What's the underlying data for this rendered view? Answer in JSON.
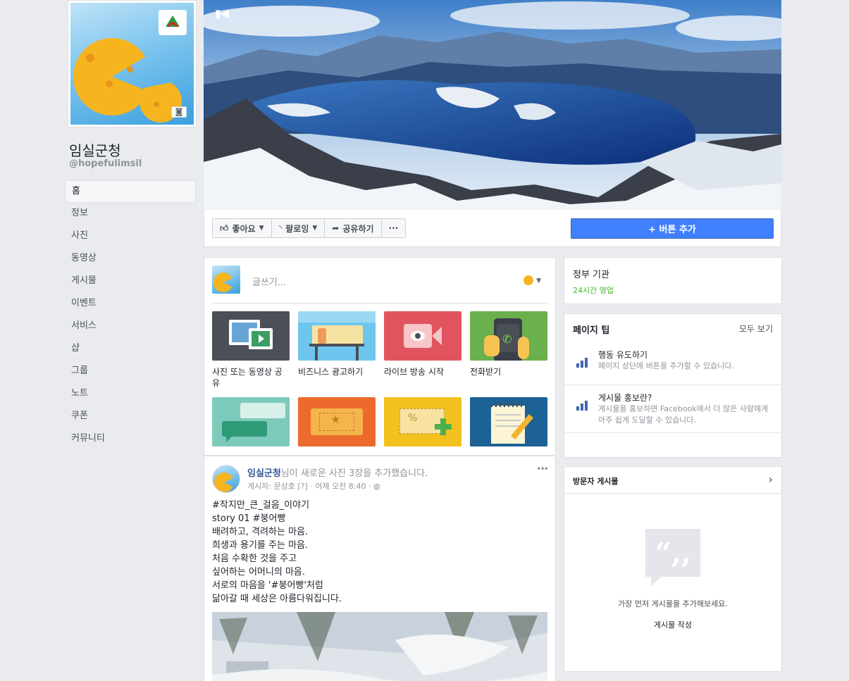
{
  "page": {
    "name": "임실군청",
    "handle": "@hopefulimsil"
  },
  "nav": {
    "items": [
      {
        "label": "홈"
      },
      {
        "label": "정보"
      },
      {
        "label": "사진"
      },
      {
        "label": "동영상"
      },
      {
        "label": "게시물"
      },
      {
        "label": "이벤트"
      },
      {
        "label": "서비스"
      },
      {
        "label": "샵"
      },
      {
        "label": "그룹"
      },
      {
        "label": "노트"
      },
      {
        "label": "쿠폰"
      },
      {
        "label": "커뮤니티"
      }
    ]
  },
  "actions": {
    "like": "좋아요",
    "follow": "팔로잉",
    "share": "공유하기",
    "more": "···",
    "add_button": "+ 버튼 추가"
  },
  "composer": {
    "placeholder": "글쓰기...",
    "tiles": [
      {
        "label": "사진 또는 동영상 공유",
        "icon": "photo-video-icon"
      },
      {
        "label": "비즈니스 광고하기",
        "icon": "store-icon"
      },
      {
        "label": "라이브 방송 시작",
        "icon": "live-camera-icon"
      },
      {
        "label": "전화받기",
        "icon": "phone-icon"
      },
      {
        "label": "",
        "icon": "chat-bubbles-icon"
      },
      {
        "label": "",
        "icon": "ticket-icon"
      },
      {
        "label": "",
        "icon": "coupon-icon"
      },
      {
        "label": "",
        "icon": "note-icon"
      }
    ]
  },
  "post": {
    "author": "임실군청",
    "action_text": "님이 새로운 사진 3장을 추가했습니다.",
    "meta": "게시자: 문상호 [?] · 어제 오전 8:40 · ",
    "more": "···",
    "lines": [
      "#작지만_큰_걸음_이야기",
      "story 01 #붕어빵",
      "배려하고, 격려하는 마음.",
      "희생과 용기를 주는 마음.",
      "처음 수확한 것을 주고",
      "싶어하는 어머니의 마음.",
      "서로의 마음을 '#붕어빵'처럼",
      "닮아갈 때 세상은 아름다워집니다."
    ]
  },
  "about": {
    "category": "정부 기관",
    "hours": "24시간 영업"
  },
  "tips": {
    "title": "페이지 팁",
    "see_all": "모두 보기",
    "items": [
      {
        "title": "행동 유도하기",
        "desc": "페이지 상단에 버튼을 추가할 수 있습니다."
      },
      {
        "title": "게시물 홍보란?",
        "desc": "게시물을 홍보하면 Facebook에서 더 많은 사람에게 아주 쉽게 도달할 수 있습니다."
      }
    ]
  },
  "visitor": {
    "title": "방문자 게시물",
    "empty": "가장 먼저 게시물을 추가해보세요.",
    "write": "게시물 작성"
  },
  "colors": {
    "accent": "#4080ff",
    "link": "#365899",
    "green": "#42b72a",
    "background": "#e9ebee"
  }
}
